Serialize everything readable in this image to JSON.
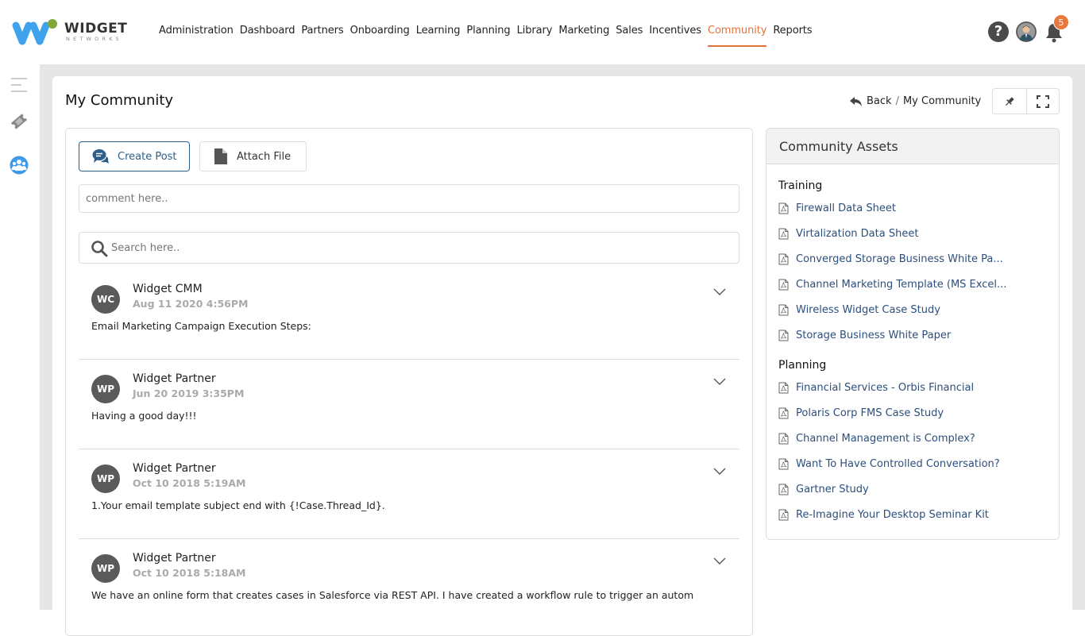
{
  "brand": {
    "name": "WIDGET",
    "tagline": "NETWORKS"
  },
  "nav": {
    "items": [
      "Administration",
      "Dashboard",
      "Partners",
      "Onboarding",
      "Learning",
      "Planning",
      "Library",
      "Marketing",
      "Sales",
      "Incentives",
      "Community",
      "Reports"
    ],
    "active": "Community",
    "accent_color": "#e0733a"
  },
  "header_icons": {
    "help": "?",
    "notifications_count": "5"
  },
  "page": {
    "title": "My Community",
    "breadcrumb": {
      "back": "Back",
      "separator": "/",
      "current": "My Community"
    }
  },
  "feed": {
    "create_post_label": "Create Post",
    "attach_file_label": "Attach File",
    "comment_placeholder": "comment here..",
    "search_placeholder": "Search here..",
    "posts": [
      {
        "initials": "WC",
        "author": "Widget CMM",
        "time": "Aug 11 2020 4:56PM",
        "body": "Email Marketing Campaign Execution Steps:"
      },
      {
        "initials": "WP",
        "author": "Widget Partner",
        "time": "Jun 20 2019 3:35PM",
        "body": "Having a good day!!!"
      },
      {
        "initials": "WP",
        "author": "Widget Partner",
        "time": "Oct 10 2018 5:19AM",
        "body": "1.Your email template subject end with {!Case.Thread_Id}."
      },
      {
        "initials": "WP",
        "author": "Widget Partner",
        "time": "Oct 10 2018 5:18AM",
        "body": "We have an online form that creates cases in Salesforce via REST API. I have created a workflow rule to trigger an autom"
      }
    ]
  },
  "assets": {
    "title": "Community Assets",
    "sections": [
      {
        "name": "Training",
        "items": [
          "Firewall Data Sheet",
          "Virtalization Data Sheet",
          " Converged Storage Business White Pa...",
          " Channel Marketing Template (MS Excel...",
          "Wireless Widget Case Study",
          "Storage Business White Paper"
        ]
      },
      {
        "name": "Planning",
        "items": [
          "Financial Services - Orbis Financial",
          "Polaris Corp FMS Case Study",
          "Channel Management is Complex?",
          "Want To Have Controlled Conversation?",
          "Gartner Study",
          "Re-Imagine Your Desktop Seminar Kit"
        ]
      }
    ]
  }
}
